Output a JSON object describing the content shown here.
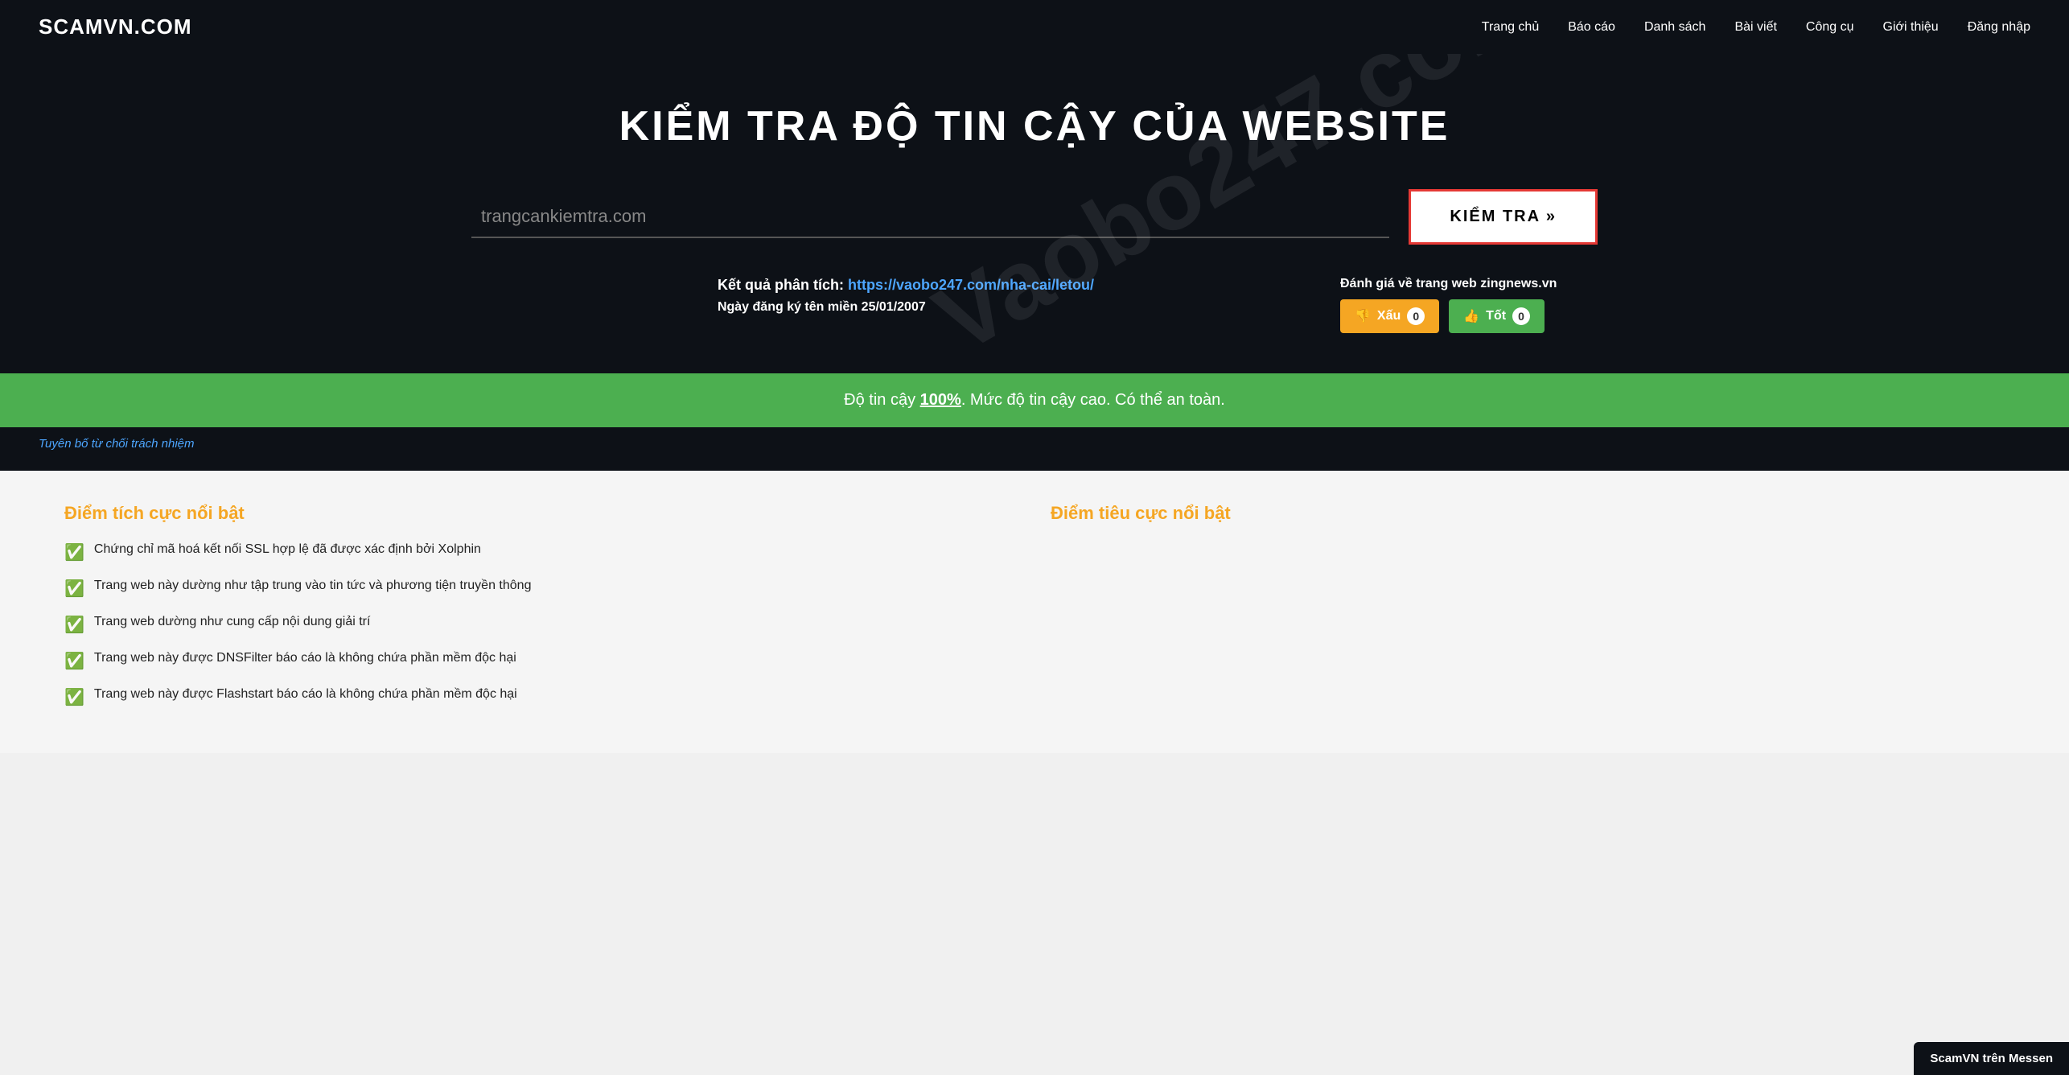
{
  "site": {
    "logo": "SCAMVN.COM"
  },
  "nav": {
    "items": [
      {
        "label": "Trang chủ",
        "id": "trang-chu"
      },
      {
        "label": "Báo cáo",
        "id": "bao-cao"
      },
      {
        "label": "Danh sách",
        "id": "danh-sach"
      },
      {
        "label": "Bài viết",
        "id": "bai-viet"
      },
      {
        "label": "Công cụ",
        "id": "cong-cu"
      },
      {
        "label": "Giới thiệu",
        "id": "gioi-thieu"
      },
      {
        "label": "Đăng nhập",
        "id": "dang-nhap"
      }
    ]
  },
  "hero": {
    "title": "KIỂM TRA ĐỘ TIN CẬY CỦA WEBSITE",
    "watermark": "Vaobo247.com",
    "search_placeholder": "trangcankiemtra.com",
    "search_button": "KIỂM TRA »"
  },
  "result": {
    "label": "Kết quả phân tích:",
    "url": "https://vaobo247.com/nha-cai/letou/",
    "date_label": "Ngày đăng ký tên miền 25/01/2007",
    "rating_label": "Đánh giá về trang web zingnews.vn",
    "bad_button": "👎 Xấu",
    "bad_count": "0",
    "good_button": "👍 Tốt",
    "good_count": "0"
  },
  "trust_bar": {
    "text_before": "Độ tin cậy ",
    "percent": "100%",
    "text_after": ". Mức độ tin cậy cao. Có thể an toàn."
  },
  "disclaimer": {
    "link_text": "Tuyên bố từ chối trách nhiệm"
  },
  "positives": {
    "title": "Điểm tích cực nổi bật",
    "items": [
      "Chứng chỉ mã hoá kết nối SSL hợp lệ đã được xác định bởi Xolphin",
      "Trang web này dường như tập trung vào tin tức và phương tiện truyền thông",
      "Trang web dường như cung cấp nội dung giải trí",
      "Trang web này được DNSFilter báo cáo là không chứa phần mềm độc hại",
      "Trang web này được Flashstart báo cáo là không chứa phần mềm độc hại"
    ]
  },
  "negatives": {
    "title": "Điểm tiêu cực nổi bật",
    "items": []
  },
  "messenger": {
    "label": "ScamVN trên Messen"
  }
}
